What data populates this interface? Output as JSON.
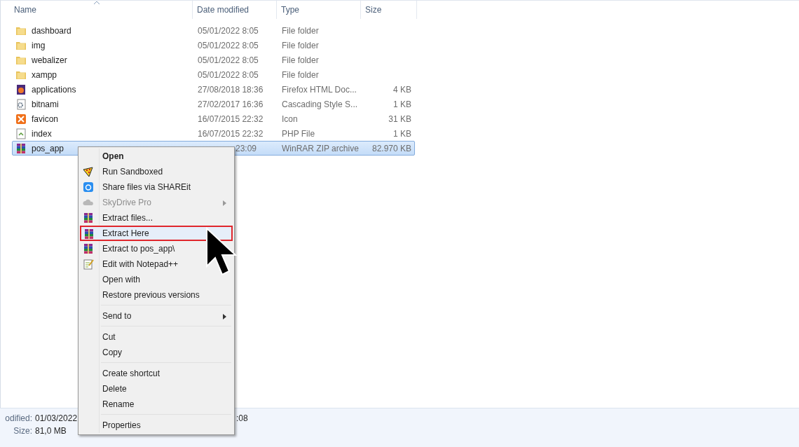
{
  "columns": [
    {
      "label": "Name",
      "sorted": true
    },
    {
      "label": "Date modified",
      "sorted": false
    },
    {
      "label": "Type",
      "sorted": false
    },
    {
      "label": "Size",
      "sorted": false
    }
  ],
  "files": [
    {
      "name": "dashboard",
      "kind": "folder",
      "date": "05/01/2022 8:05",
      "type": "File folder",
      "selected": false
    },
    {
      "name": "img",
      "kind": "folder",
      "date": "05/01/2022 8:05",
      "type": "File folder",
      "selected": false
    },
    {
      "name": "webalizer",
      "kind": "folder",
      "date": "05/01/2022 8:05",
      "type": "File folder",
      "selected": false
    },
    {
      "name": "xampp",
      "kind": "folder",
      "date": "05/01/2022 8:05",
      "type": "File folder",
      "selected": false
    },
    {
      "name": "applications",
      "kind": "html",
      "date": "27/08/2018 18:36",
      "type": "Firefox HTML Doc...",
      "size": "4 KB",
      "selected": false
    },
    {
      "name": "bitnami",
      "kind": "css",
      "date": "27/02/2017 16:36",
      "type": "Cascading Style S...",
      "size": "1 KB",
      "selected": false
    },
    {
      "name": "favicon",
      "kind": "icon",
      "date": "16/07/2015 22:32",
      "type": "Icon",
      "size": "31 KB",
      "selected": false
    },
    {
      "name": "index",
      "kind": "php",
      "date": "16/07/2015 22:32",
      "type": "PHP File",
      "size": "1 KB",
      "selected": false
    },
    {
      "name": "pos_app",
      "kind": "archive",
      "date": "23:09",
      "type": "WinRAR ZIP archive",
      "size": "82.970 KB",
      "selected": true
    }
  ],
  "context_menu": [
    {
      "kind": "plain",
      "label": "Open",
      "default": true,
      "disabled": false,
      "submenu": false,
      "highlighted": false
    },
    {
      "kind": "sandbox",
      "label": "Run Sandboxed",
      "default": false,
      "disabled": false,
      "submenu": false,
      "highlighted": false
    },
    {
      "kind": "share",
      "label": "Share files via SHAREit",
      "default": false,
      "disabled": false,
      "submenu": false,
      "highlighted": false
    },
    {
      "kind": "cloud",
      "label": "SkyDrive Pro",
      "default": false,
      "disabled": true,
      "submenu": true,
      "highlighted": false
    },
    {
      "kind": "archive",
      "label": "Extract files...",
      "default": false,
      "disabled": false,
      "submenu": false,
      "highlighted": false
    },
    {
      "kind": "archive",
      "label": "Extract Here",
      "default": false,
      "disabled": false,
      "submenu": false,
      "highlighted": true
    },
    {
      "kind": "archive",
      "label": "Extract to pos_app\\",
      "default": false,
      "disabled": false,
      "submenu": false,
      "highlighted": false
    },
    {
      "kind": "editor",
      "label": "Edit with Notepad++",
      "default": false,
      "disabled": false,
      "submenu": false,
      "highlighted": false
    },
    {
      "kind": "plain",
      "label": "Open with",
      "default": false,
      "disabled": false,
      "submenu": false,
      "highlighted": false
    },
    {
      "kind": "plain",
      "label": "Restore previous versions",
      "default": false,
      "disabled": false,
      "submenu": false,
      "highlighted": false
    },
    {
      "kind": "separator"
    },
    {
      "kind": "plain",
      "label": "Send to",
      "default": false,
      "disabled": false,
      "submenu": true,
      "highlighted": false
    },
    {
      "kind": "separator"
    },
    {
      "kind": "plain",
      "label": "Cut",
      "default": false,
      "disabled": false,
      "submenu": false,
      "highlighted": false
    },
    {
      "kind": "plain",
      "label": "Copy",
      "default": false,
      "disabled": false,
      "submenu": false,
      "highlighted": false
    },
    {
      "kind": "separator"
    },
    {
      "kind": "plain",
      "label": "Create shortcut",
      "default": false,
      "disabled": false,
      "submenu": false,
      "highlighted": false
    },
    {
      "kind": "plain",
      "label": "Delete",
      "default": false,
      "disabled": false,
      "submenu": false,
      "highlighted": false
    },
    {
      "kind": "plain",
      "label": "Rename",
      "default": false,
      "disabled": false,
      "submenu": false,
      "highlighted": false
    },
    {
      "kind": "separator"
    },
    {
      "kind": "plain",
      "label": "Properties",
      "default": false,
      "disabled": false,
      "submenu": false,
      "highlighted": false
    }
  ],
  "details": {
    "modified_label": "odified:",
    "modified_value": "01/03/2022",
    "modified_tail": ":08",
    "size_label": "Size:",
    "size_value": "81,0 MB"
  }
}
